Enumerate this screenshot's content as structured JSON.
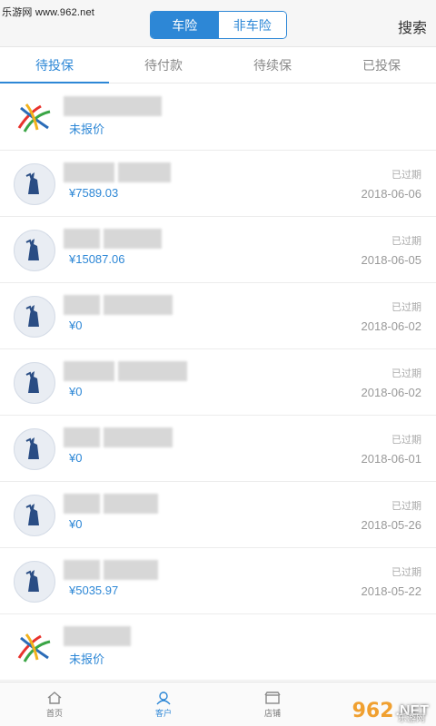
{
  "watermark": "乐游网 www.962.net",
  "header": {
    "segment": [
      "车险",
      "非车险"
    ],
    "search_label": "搜索"
  },
  "tabs": [
    "待投保",
    "待付款",
    "待续保",
    "已投保"
  ],
  "rows": [
    {
      "logo": "colorful-x-logo",
      "amount": "未报价",
      "status": "",
      "date": ""
    },
    {
      "logo": "statue-of-liberty-logo",
      "amount": "¥7589.03",
      "status": "已过期",
      "date": "2018-06-06"
    },
    {
      "logo": "statue-of-liberty-logo",
      "amount": "¥15087.06",
      "status": "已过期",
      "date": "2018-06-05"
    },
    {
      "logo": "statue-of-liberty-logo",
      "amount": "¥0",
      "status": "已过期",
      "date": "2018-06-02"
    },
    {
      "logo": "statue-of-liberty-logo",
      "amount": "¥0",
      "status": "已过期",
      "date": "2018-06-02"
    },
    {
      "logo": "statue-of-liberty-logo",
      "amount": "¥0",
      "status": "已过期",
      "date": "2018-06-01"
    },
    {
      "logo": "statue-of-liberty-logo",
      "amount": "¥0",
      "status": "已过期",
      "date": "2018-05-26"
    },
    {
      "logo": "statue-of-liberty-logo",
      "amount": "¥5035.97",
      "status": "已过期",
      "date": "2018-05-22"
    },
    {
      "logo": "colorful-x-logo",
      "amount": "未报价",
      "status": "",
      "date": ""
    }
  ],
  "bottomnav": [
    {
      "icon": "home-icon",
      "label": "首页"
    },
    {
      "icon": "customer-icon",
      "label": "客户"
    },
    {
      "icon": "store-icon",
      "label": "店铺"
    },
    {
      "icon": "",
      "label": ""
    }
  ],
  "corner_watermark": {
    "num": "962",
    "net": ".NET",
    "sub": "乐游网"
  },
  "colors": {
    "accent": "#2d87d6"
  }
}
